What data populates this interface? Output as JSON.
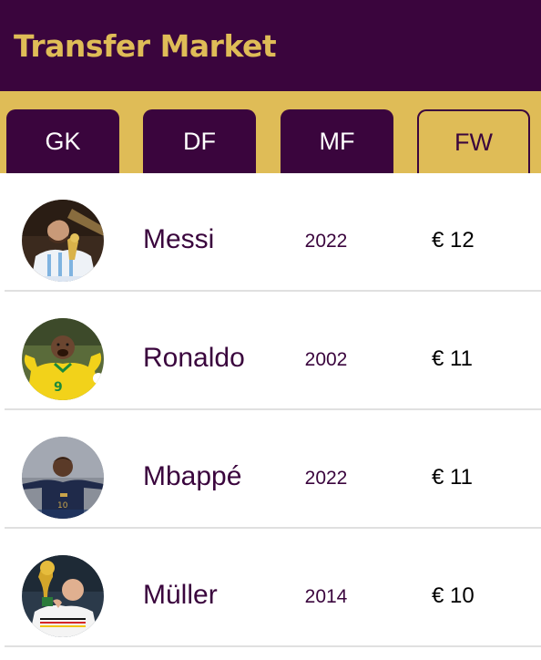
{
  "header": {
    "title": "Transfer Market"
  },
  "tabs": [
    {
      "label": "GK"
    },
    {
      "label": "DF"
    },
    {
      "label": "MF"
    },
    {
      "label": "FW"
    }
  ],
  "active_tab": "FW",
  "players": [
    {
      "name": "Messi",
      "year": "2022",
      "price": "€ 12"
    },
    {
      "name": "Ronaldo",
      "year": "2002",
      "price": "€ 11"
    },
    {
      "name": "Mbappé",
      "year": "2022",
      "price": "€ 11"
    },
    {
      "name": "Müller",
      "year": "2014",
      "price": "€ 10"
    }
  ],
  "colors": {
    "primary": "#3a053d",
    "accent": "#dfbc57",
    "divider": "#e0e0e0"
  }
}
